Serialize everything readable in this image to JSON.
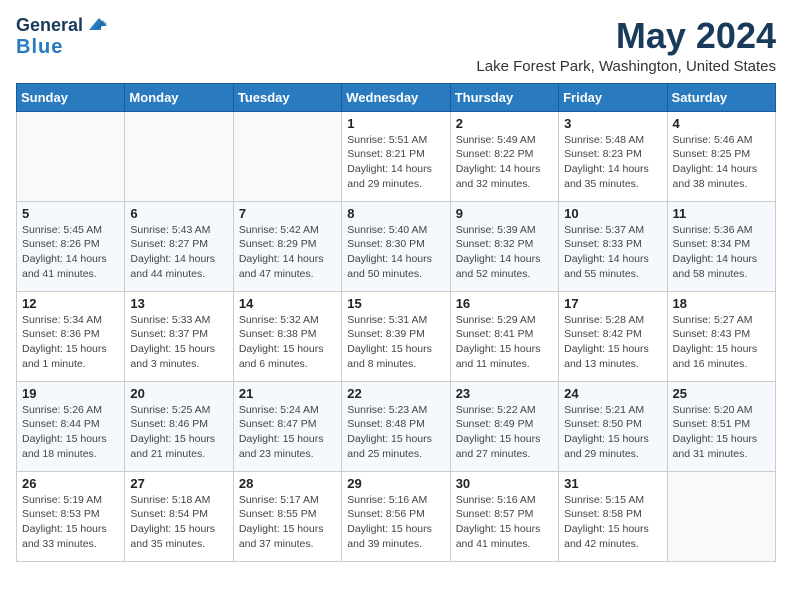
{
  "header": {
    "logo_line1": "General",
    "logo_line2": "Blue",
    "month": "May 2024",
    "location": "Lake Forest Park, Washington, United States"
  },
  "days_of_week": [
    "Sunday",
    "Monday",
    "Tuesday",
    "Wednesday",
    "Thursday",
    "Friday",
    "Saturday"
  ],
  "weeks": [
    [
      {
        "day": "",
        "sunrise": "",
        "sunset": "",
        "daylight": ""
      },
      {
        "day": "",
        "sunrise": "",
        "sunset": "",
        "daylight": ""
      },
      {
        "day": "",
        "sunrise": "",
        "sunset": "",
        "daylight": ""
      },
      {
        "day": "1",
        "sunrise": "Sunrise: 5:51 AM",
        "sunset": "Sunset: 8:21 PM",
        "daylight": "Daylight: 14 hours and 29 minutes."
      },
      {
        "day": "2",
        "sunrise": "Sunrise: 5:49 AM",
        "sunset": "Sunset: 8:22 PM",
        "daylight": "Daylight: 14 hours and 32 minutes."
      },
      {
        "day": "3",
        "sunrise": "Sunrise: 5:48 AM",
        "sunset": "Sunset: 8:23 PM",
        "daylight": "Daylight: 14 hours and 35 minutes."
      },
      {
        "day": "4",
        "sunrise": "Sunrise: 5:46 AM",
        "sunset": "Sunset: 8:25 PM",
        "daylight": "Daylight: 14 hours and 38 minutes."
      }
    ],
    [
      {
        "day": "5",
        "sunrise": "Sunrise: 5:45 AM",
        "sunset": "Sunset: 8:26 PM",
        "daylight": "Daylight: 14 hours and 41 minutes."
      },
      {
        "day": "6",
        "sunrise": "Sunrise: 5:43 AM",
        "sunset": "Sunset: 8:27 PM",
        "daylight": "Daylight: 14 hours and 44 minutes."
      },
      {
        "day": "7",
        "sunrise": "Sunrise: 5:42 AM",
        "sunset": "Sunset: 8:29 PM",
        "daylight": "Daylight: 14 hours and 47 minutes."
      },
      {
        "day": "8",
        "sunrise": "Sunrise: 5:40 AM",
        "sunset": "Sunset: 8:30 PM",
        "daylight": "Daylight: 14 hours and 50 minutes."
      },
      {
        "day": "9",
        "sunrise": "Sunrise: 5:39 AM",
        "sunset": "Sunset: 8:32 PM",
        "daylight": "Daylight: 14 hours and 52 minutes."
      },
      {
        "day": "10",
        "sunrise": "Sunrise: 5:37 AM",
        "sunset": "Sunset: 8:33 PM",
        "daylight": "Daylight: 14 hours and 55 minutes."
      },
      {
        "day": "11",
        "sunrise": "Sunrise: 5:36 AM",
        "sunset": "Sunset: 8:34 PM",
        "daylight": "Daylight: 14 hours and 58 minutes."
      }
    ],
    [
      {
        "day": "12",
        "sunrise": "Sunrise: 5:34 AM",
        "sunset": "Sunset: 8:36 PM",
        "daylight": "Daylight: 15 hours and 1 minute."
      },
      {
        "day": "13",
        "sunrise": "Sunrise: 5:33 AM",
        "sunset": "Sunset: 8:37 PM",
        "daylight": "Daylight: 15 hours and 3 minutes."
      },
      {
        "day": "14",
        "sunrise": "Sunrise: 5:32 AM",
        "sunset": "Sunset: 8:38 PM",
        "daylight": "Daylight: 15 hours and 6 minutes."
      },
      {
        "day": "15",
        "sunrise": "Sunrise: 5:31 AM",
        "sunset": "Sunset: 8:39 PM",
        "daylight": "Daylight: 15 hours and 8 minutes."
      },
      {
        "day": "16",
        "sunrise": "Sunrise: 5:29 AM",
        "sunset": "Sunset: 8:41 PM",
        "daylight": "Daylight: 15 hours and 11 minutes."
      },
      {
        "day": "17",
        "sunrise": "Sunrise: 5:28 AM",
        "sunset": "Sunset: 8:42 PM",
        "daylight": "Daylight: 15 hours and 13 minutes."
      },
      {
        "day": "18",
        "sunrise": "Sunrise: 5:27 AM",
        "sunset": "Sunset: 8:43 PM",
        "daylight": "Daylight: 15 hours and 16 minutes."
      }
    ],
    [
      {
        "day": "19",
        "sunrise": "Sunrise: 5:26 AM",
        "sunset": "Sunset: 8:44 PM",
        "daylight": "Daylight: 15 hours and 18 minutes."
      },
      {
        "day": "20",
        "sunrise": "Sunrise: 5:25 AM",
        "sunset": "Sunset: 8:46 PM",
        "daylight": "Daylight: 15 hours and 21 minutes."
      },
      {
        "day": "21",
        "sunrise": "Sunrise: 5:24 AM",
        "sunset": "Sunset: 8:47 PM",
        "daylight": "Daylight: 15 hours and 23 minutes."
      },
      {
        "day": "22",
        "sunrise": "Sunrise: 5:23 AM",
        "sunset": "Sunset: 8:48 PM",
        "daylight": "Daylight: 15 hours and 25 minutes."
      },
      {
        "day": "23",
        "sunrise": "Sunrise: 5:22 AM",
        "sunset": "Sunset: 8:49 PM",
        "daylight": "Daylight: 15 hours and 27 minutes."
      },
      {
        "day": "24",
        "sunrise": "Sunrise: 5:21 AM",
        "sunset": "Sunset: 8:50 PM",
        "daylight": "Daylight: 15 hours and 29 minutes."
      },
      {
        "day": "25",
        "sunrise": "Sunrise: 5:20 AM",
        "sunset": "Sunset: 8:51 PM",
        "daylight": "Daylight: 15 hours and 31 minutes."
      }
    ],
    [
      {
        "day": "26",
        "sunrise": "Sunrise: 5:19 AM",
        "sunset": "Sunset: 8:53 PM",
        "daylight": "Daylight: 15 hours and 33 minutes."
      },
      {
        "day": "27",
        "sunrise": "Sunrise: 5:18 AM",
        "sunset": "Sunset: 8:54 PM",
        "daylight": "Daylight: 15 hours and 35 minutes."
      },
      {
        "day": "28",
        "sunrise": "Sunrise: 5:17 AM",
        "sunset": "Sunset: 8:55 PM",
        "daylight": "Daylight: 15 hours and 37 minutes."
      },
      {
        "day": "29",
        "sunrise": "Sunrise: 5:16 AM",
        "sunset": "Sunset: 8:56 PM",
        "daylight": "Daylight: 15 hours and 39 minutes."
      },
      {
        "day": "30",
        "sunrise": "Sunrise: 5:16 AM",
        "sunset": "Sunset: 8:57 PM",
        "daylight": "Daylight: 15 hours and 41 minutes."
      },
      {
        "day": "31",
        "sunrise": "Sunrise: 5:15 AM",
        "sunset": "Sunset: 8:58 PM",
        "daylight": "Daylight: 15 hours and 42 minutes."
      },
      {
        "day": "",
        "sunrise": "",
        "sunset": "",
        "daylight": ""
      }
    ]
  ]
}
